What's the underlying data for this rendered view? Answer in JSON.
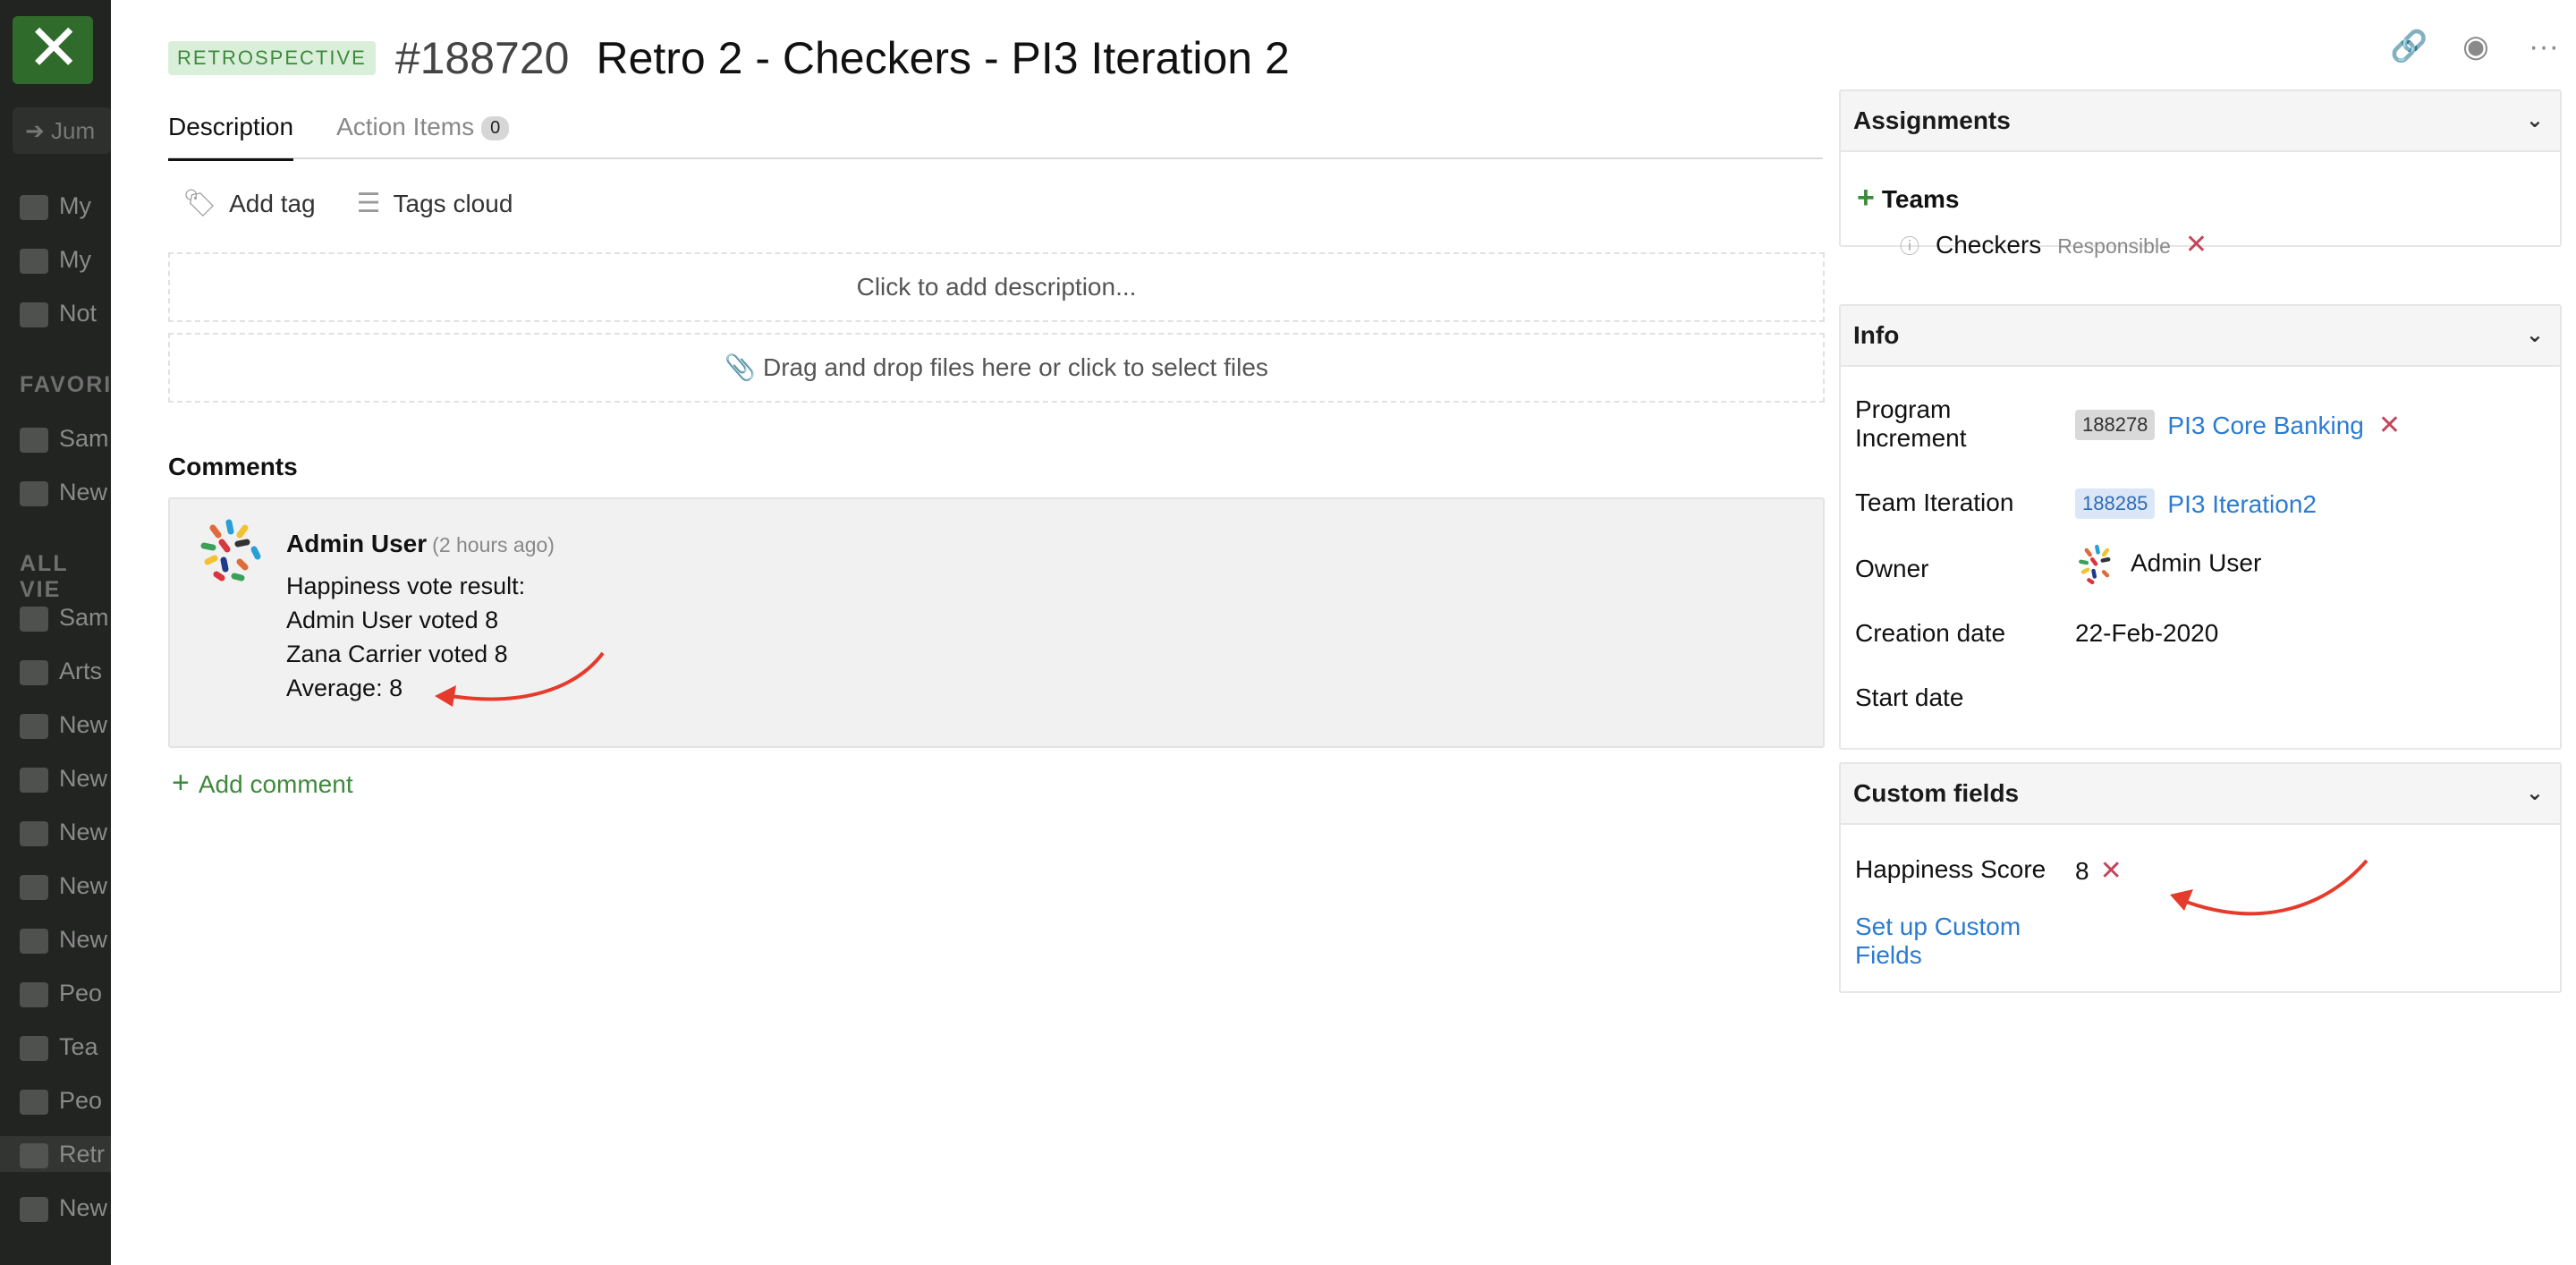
{
  "sidebar": {
    "close_icon": "close-icon",
    "jump_label": "Jum",
    "items_top": [
      "My",
      "My",
      "Not"
    ],
    "favorites_heading": "FAVORI",
    "favorites": [
      "Sam",
      "New"
    ],
    "all_views_heading": "ALL VIE",
    "views": [
      "Sam",
      "Arts",
      "New",
      "New",
      "New",
      "New",
      "New",
      "Peo",
      "Tea",
      "Peo",
      "Retr",
      "New"
    ]
  },
  "entity": {
    "type_badge": "RETROSPECTIVE",
    "id": "#188720",
    "title": "Retro 2 - Checkers - PI3 Iteration 2"
  },
  "tabs": [
    {
      "label": "Description",
      "active": true
    },
    {
      "label": "Action Items",
      "count": "0"
    }
  ],
  "tags": {
    "add_tag": "Add tag",
    "tags_cloud": "Tags cloud"
  },
  "description_placeholder": "Click to add description...",
  "files_placeholder": "Drag and drop files here or click to select files",
  "comments": {
    "heading": "Comments",
    "items": [
      {
        "author": "Admin User",
        "time": "(2 hours ago)",
        "lines": [
          "Happiness vote result:",
          "Admin User voted 8",
          "Zana Carrier voted 8",
          "Average: 8"
        ]
      }
    ],
    "add_label": "Add comment"
  },
  "assignments": {
    "heading": "Assignments",
    "teams_label": "Teams",
    "team_name": "Checkers",
    "team_role": "Responsible"
  },
  "info": {
    "heading": "Info",
    "program_increment_label": "Program Increment",
    "program_increment_id": "188278",
    "program_increment_value": "PI3 Core Banking",
    "team_iteration_label": "Team Iteration",
    "team_iteration_id": "188285",
    "team_iteration_value": "PI3 Iteration2",
    "owner_label": "Owner",
    "owner_value": "Admin User",
    "creation_date_label": "Creation date",
    "creation_date_value": "22-Feb-2020",
    "start_date_label": "Start date",
    "start_date_value": ""
  },
  "custom_fields": {
    "heading": "Custom fields",
    "happiness_label": "Happiness Score",
    "happiness_value": "8",
    "setup_link": "Set up Custom Fields"
  },
  "colors": {
    "accent_green": "#3d8a3d",
    "link_blue": "#2b7bd1",
    "remove_red": "#c3455a",
    "annotation_red": "#e53b2c"
  }
}
